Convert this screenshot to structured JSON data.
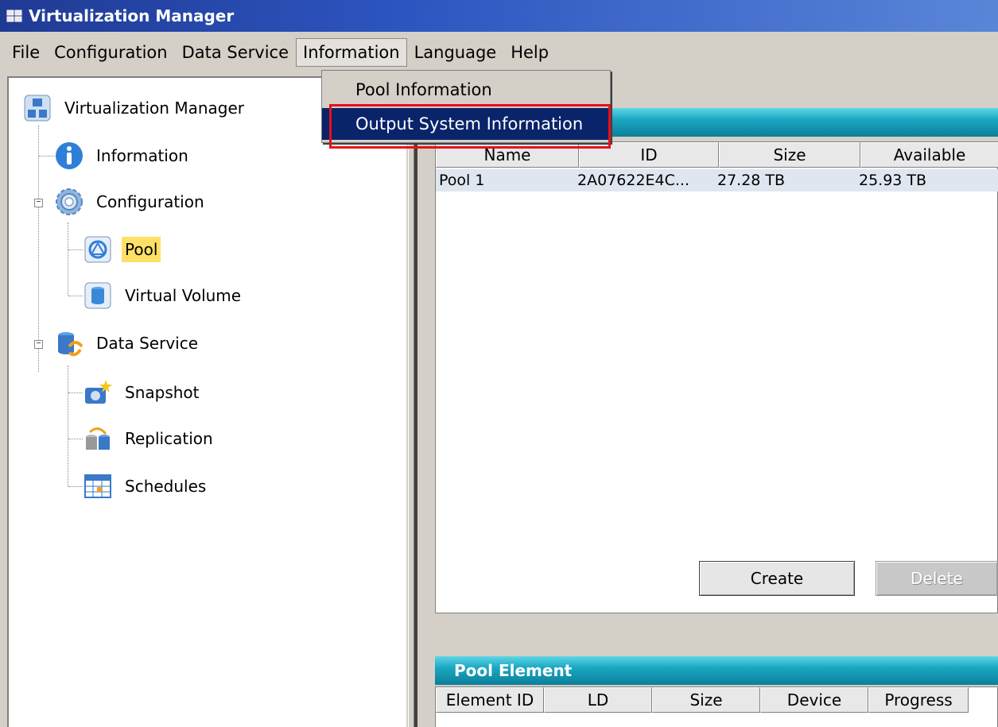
{
  "window": {
    "title": "Virtualization Manager"
  },
  "menubar": {
    "items": [
      "File",
      "Configuration",
      "Data Service",
      "Information",
      "Language",
      "Help"
    ],
    "open_menu": "Information"
  },
  "dropdown": {
    "items": [
      "Pool Information",
      "Output System Information"
    ],
    "highlighted": "Output System Information"
  },
  "tree": {
    "root": "Virtualization Manager",
    "nodes": {
      "information": "Information",
      "configuration": "Configuration",
      "pool": "Pool",
      "virtual_volume": "Virtual Volume",
      "data_service": "Data Service",
      "snapshot": "Snapshot",
      "replication": "Replication",
      "schedules": "Schedules"
    },
    "selected": "Pool"
  },
  "pool_table": {
    "columns": [
      "Name",
      "ID",
      "Size",
      "Available"
    ],
    "rows": [
      {
        "name": "Pool 1",
        "id": "2A07622E4C...",
        "size": "27.28 TB",
        "available": "25.93 TB"
      }
    ]
  },
  "buttons": {
    "create": "Create",
    "delete": "Delete"
  },
  "pool_element": {
    "title": "Pool Element",
    "columns": [
      "Element ID",
      "LD",
      "Size",
      "Device",
      "Progress"
    ]
  },
  "colors": {
    "highlight": "#0a246a",
    "selected_bg": "#ffe066",
    "header_teal": "#1aa7c1",
    "annotation_red": "#e8101a"
  }
}
